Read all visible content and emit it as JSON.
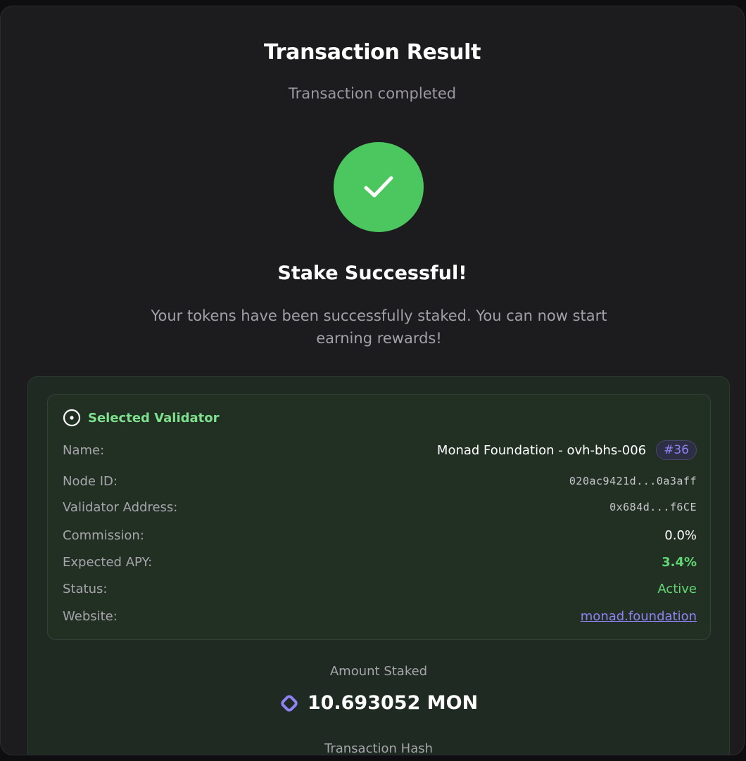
{
  "modal": {
    "title": "Transaction Result",
    "subtitle": "Transaction completed"
  },
  "result": {
    "status_icon": "checkmark-icon",
    "heading": "Stake Successful!",
    "message": "Your tokens have been successfully staked. You can now start earning rewards!"
  },
  "validator": {
    "header_icon": "target-icon",
    "header": "Selected Validator",
    "rows": [
      {
        "label": "Name:",
        "value": "Monad Foundation - ovh-bhs-006",
        "badge": "#36"
      },
      {
        "label": "Node ID:",
        "value": "020ac9421d...0a3aff"
      },
      {
        "label": "Validator Address:",
        "value": "0x684d...f6CE"
      },
      {
        "label": "Commission:",
        "value": "0.0%"
      },
      {
        "label": "Expected APY:",
        "value": "3.4%"
      },
      {
        "label": "Status:",
        "value": "Active"
      },
      {
        "label": "Website:",
        "value": "monad.foundation"
      }
    ]
  },
  "amount": {
    "label": "Amount Staked",
    "token_icon": "monad-token-icon",
    "value": "10.693052 MON"
  },
  "transaction": {
    "hash_label": "Transaction Hash"
  },
  "colors": {
    "success": "#4cc760",
    "accent_green": "#62d674",
    "accent_purple": "#8d83f5",
    "background": "#1c1b1e",
    "card": "#223024"
  }
}
